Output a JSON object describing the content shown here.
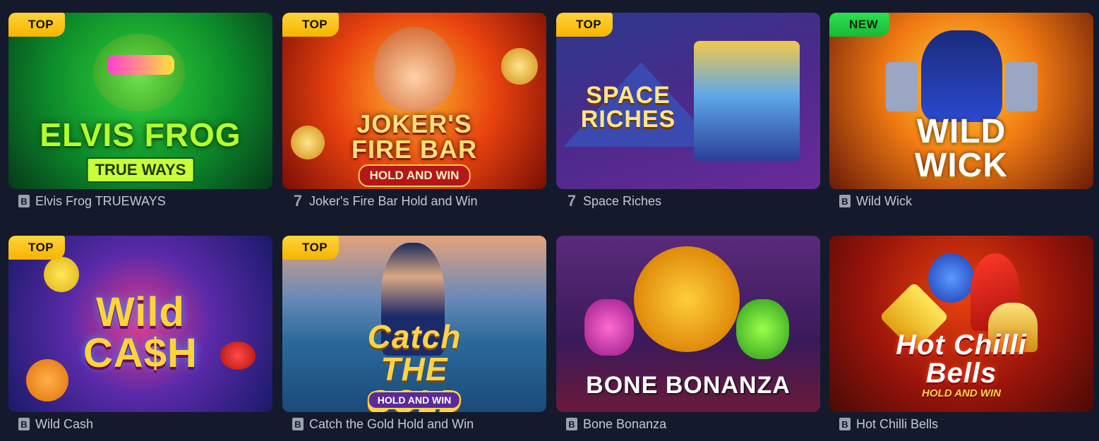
{
  "games": [
    {
      "name": "Elvis Frog TRUEWAYS",
      "provider_icon": "b-icon",
      "badge": "TOP",
      "art_title": "ELVIS FROG",
      "art_subtitle": "TRUE WAYS"
    },
    {
      "name": "Joker's Fire Bar Hold and Win",
      "provider_icon": "seven-icon",
      "badge": "TOP",
      "art_title": "JOKER'S FIRE BAR",
      "art_subtitle": "HOLD AND WIN"
    },
    {
      "name": "Space Riches",
      "provider_icon": "seven-icon",
      "badge": "TOP",
      "art_title": "SPACE RICHES",
      "art_subtitle": ""
    },
    {
      "name": "Wild Wick",
      "provider_icon": "b-icon",
      "badge": "NEW",
      "art_title": "WILD WICK",
      "art_subtitle": ""
    },
    {
      "name": "Wild Cash",
      "provider_icon": "b-icon",
      "badge": "TOP",
      "art_title": "Wild CA$H",
      "art_subtitle": ""
    },
    {
      "name": "Catch the Gold Hold and Win",
      "provider_icon": "b-icon",
      "badge": "TOP",
      "art_title": "Catch THE GOLD",
      "art_subtitle": "HOLD AND WIN"
    },
    {
      "name": "Bone Bonanza",
      "provider_icon": "b-icon",
      "badge": "",
      "art_title": "BONE BONANZA",
      "art_subtitle": ""
    },
    {
      "name": "Hot Chilli Bells",
      "provider_icon": "b-icon",
      "badge": "",
      "art_title": "Hot Chilli Bells",
      "art_subtitle": "HOLD AND WIN"
    }
  ],
  "provider_glyphs": {
    "b": "B",
    "seven": "7"
  },
  "colors": {
    "background": "#141a2b",
    "top_badge": "#f5b400",
    "new_badge": "#17b934",
    "caption": "#c3c8d6"
  }
}
